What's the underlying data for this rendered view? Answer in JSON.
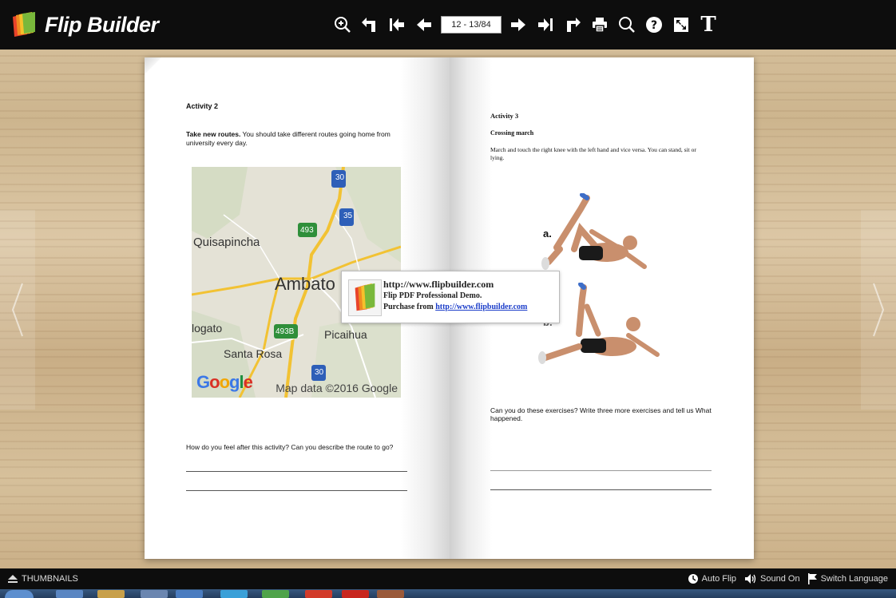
{
  "app": {
    "logo_text": "Flip Builder"
  },
  "toolbar": {
    "page_indicator": "12 - 13/84",
    "tools": [
      "zoom-in-icon",
      "back-icon",
      "first-page-icon",
      "previous-page-icon",
      "next-page-icon",
      "last-page-icon",
      "forward-icon",
      "print-icon",
      "search-icon",
      "help-icon",
      "fullscreen-icon",
      "text-icon"
    ],
    "text_tool_label": "T"
  },
  "left_page": {
    "activity_title": "Activity 2",
    "instruction_bold": "Take new routes.",
    "instruction_rest": " You should take different routes going home from university every day.",
    "map": {
      "places": [
        "Quisapincha",
        "Ambato",
        "Picaihua",
        "Santa Rosa"
      ],
      "place_partial_left": "logato",
      "highways": [
        "30",
        "35",
        "493",
        "493B",
        "30"
      ],
      "attribution": "Map data ©2016 Google",
      "brand": "Google"
    },
    "question": "How do you feel after this activity? Can you describe the route to go?"
  },
  "right_page": {
    "activity_title": "Activity 3",
    "subtitle": "Crossing march",
    "instruction": "March and touch the right knee with the left hand and vice versa. You can stand, sit or lying.",
    "exercise_labels": [
      "a.",
      "b."
    ],
    "question": "Can you do these exercises?  Write three more exercises and tell us What happened."
  },
  "demo_popup": {
    "line1": "http://www.flipbuilder.com",
    "line2": "Flip PDF Professional Demo.",
    "line3_prefix": "Purchase from ",
    "line3_link": "http://www.flipbuilder.com"
  },
  "bottom_bar": {
    "thumbnails_label": "THUMBNAILS",
    "auto_flip_label": "Auto Flip",
    "sound_label": "Sound On",
    "language_label": "Switch Language"
  },
  "colors": {
    "toolbar_bg": "#0d0d0d",
    "link": "#1a3cc9",
    "map_highway": "#f2c233",
    "map_shield_green": "#2f8f3a",
    "map_shield_blue": "#2e5fb8"
  }
}
